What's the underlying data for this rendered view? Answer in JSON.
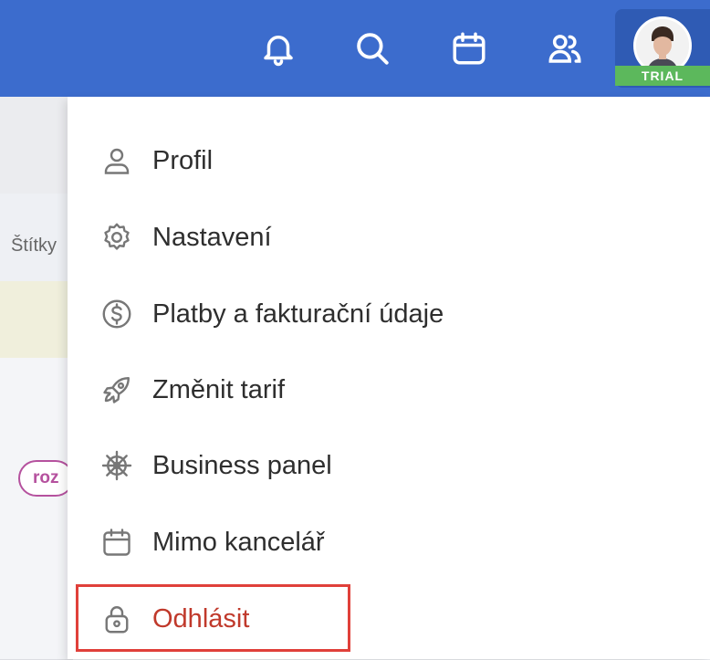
{
  "header": {
    "background_color": "#3c6ccd",
    "icons": [
      "bell-icon",
      "search-icon",
      "calendar-icon",
      "users-icon"
    ],
    "trial_badge": "TRIAL",
    "trial_color": "#5cb85c"
  },
  "background_page": {
    "column_label": "Štítky",
    "tag_pill": "roz"
  },
  "menu": {
    "items": [
      {
        "label": "Profil",
        "icon": "user-icon"
      },
      {
        "label": "Nastavení",
        "icon": "gear-icon"
      },
      {
        "label": "Platby a fakturační údaje",
        "icon": "dollar-icon"
      },
      {
        "label": "Změnit tarif",
        "icon": "rocket-icon"
      },
      {
        "label": "Business panel",
        "icon": "ship-wheel-icon"
      },
      {
        "label": "Mimo kancelář",
        "icon": "calendar-icon"
      },
      {
        "label": "Odhlásit",
        "icon": "lock-icon"
      }
    ],
    "logout_color": "#c0392b",
    "highlight_color": "#e0403a"
  }
}
